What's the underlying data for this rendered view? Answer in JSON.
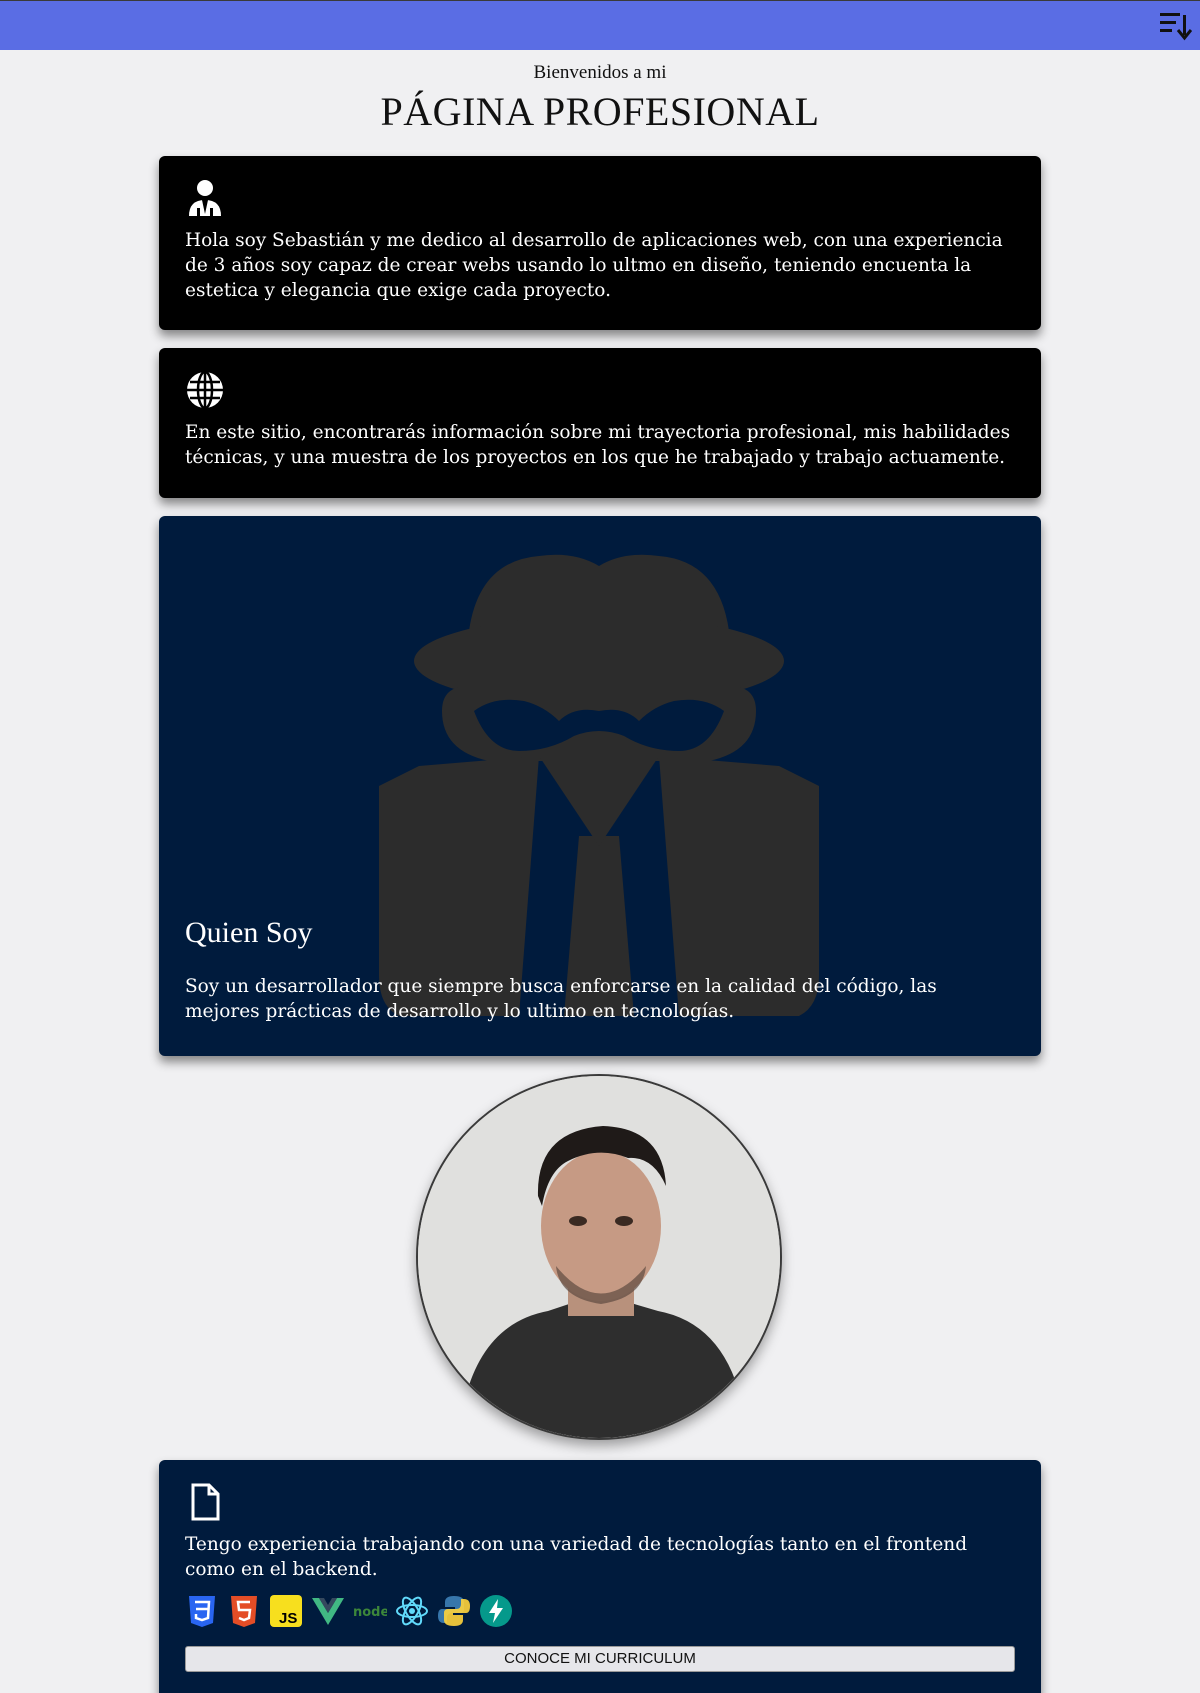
{
  "header": {
    "welcome": "Bienvenidos a mi",
    "title": "PÁGINA PROFESIONAL"
  },
  "menu": {
    "icon": "sort-menu-icon"
  },
  "cards": {
    "intro": {
      "icon": "businessman-icon",
      "text": "Hola soy Sebastián y me dedico al desarrollo de aplicaciones web, con una experiencia de 3 años soy capaz de crear webs usando lo ultmo en diseño, teniendo encuenta la estetica y elegancia que exige cada proyecto."
    },
    "site": {
      "icon": "globe-icon",
      "text": "En este sitio, encontrarás información sobre mi trayectoria profesional, mis habilidades técnicas, y una muestra de los proyectos en los que he trabajado y trabajo actuamente."
    },
    "about": {
      "icon": "spy-icon",
      "title": "Quien Soy",
      "text": "Soy un desarrollador que siempre busca enforcarse en la calidad del código, las mejores prácticas de desarrollo y lo ultimo en tecnologías."
    },
    "tech": {
      "icon": "document-icon",
      "text": "Tengo experiencia trabajando con una variedad de tecnologías tanto en el frontend como en el backend.",
      "logos": [
        "css3-icon",
        "html5-icon",
        "javascript-icon",
        "vue-icon",
        "node-icon",
        "react-icon",
        "python-icon",
        "fastapi-icon"
      ],
      "button": "CONOCE MI CURRICULUM"
    }
  },
  "colors": {
    "topbar": "#5a6de4",
    "card_black": "#000000",
    "card_navy": "#001b3d",
    "background": "#f0f0f2"
  }
}
